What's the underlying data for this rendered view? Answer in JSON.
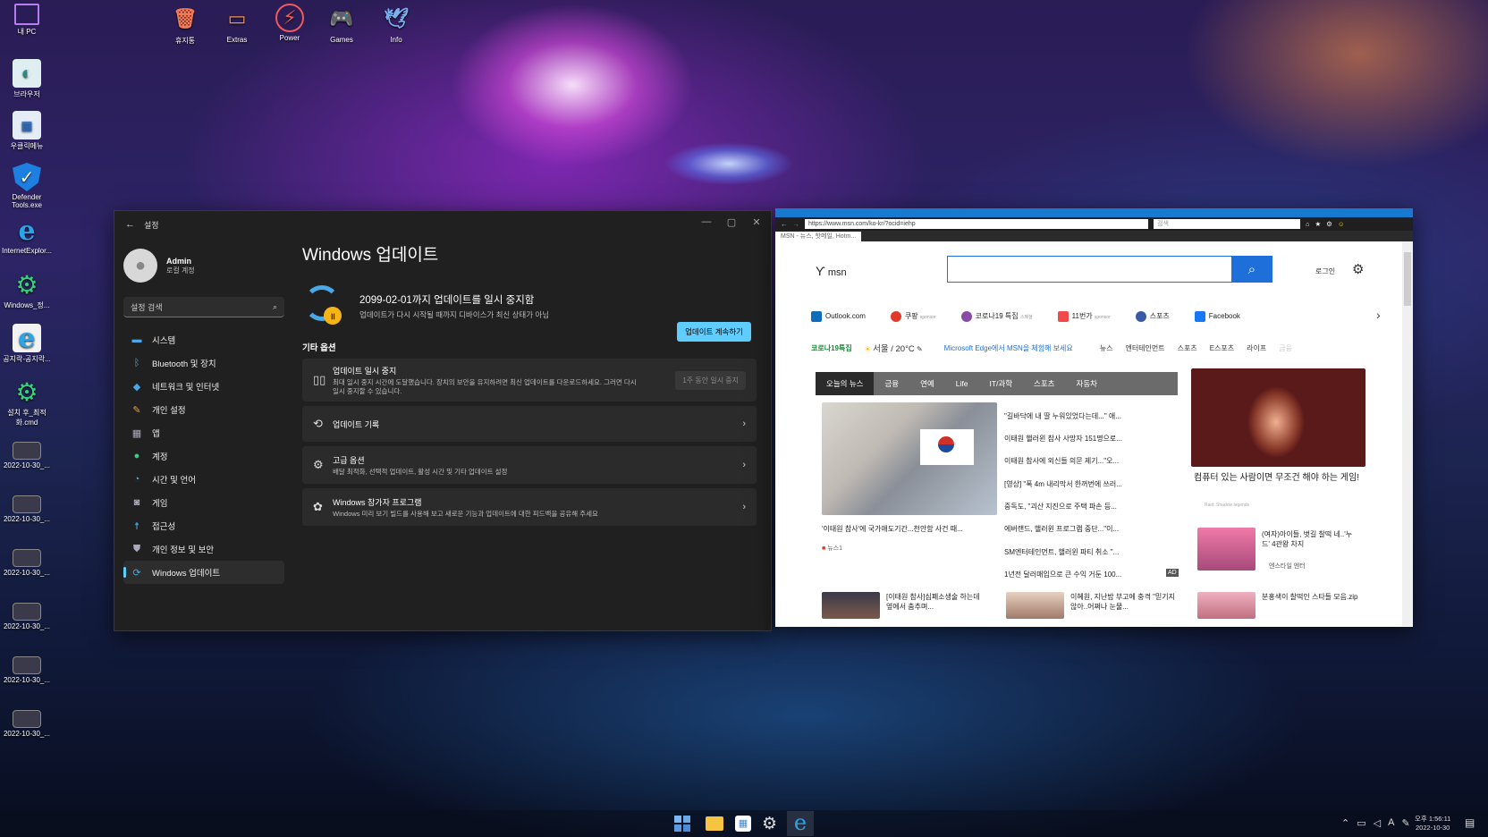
{
  "desktop_icons": [
    "내 PC",
    "브라우저",
    "우클릭메뉴",
    "Defender Tools.exe",
    "InternetExplor...",
    "Windows_정...",
    "공지락-공지락...",
    "설치 후_최적화.cmd",
    "2022-10-30_...",
    "2022-10-30_...",
    "2022-10-30_...",
    "2022-10-30_...",
    "2022-10-30_...",
    "2022-10-30_..."
  ],
  "top_icons": [
    "휴지통",
    "Extras",
    "Power",
    "Games",
    "Info"
  ],
  "settings": {
    "title": "설정",
    "user_name": "Admin",
    "user_type": "로컬 계정",
    "search_placeholder": "설정 검색",
    "nav": [
      "시스템",
      "Bluetooth 및 장치",
      "네트워크 및 인터넷",
      "개인 설정",
      "앱",
      "계정",
      "시간 및 언어",
      "게임",
      "접근성",
      "개인 정보 및 보안",
      "Windows 업데이트"
    ],
    "page_title": "Windows 업데이트",
    "paused_title": "2099-02-01까지 업데이트를 일시 중지함",
    "paused_sub": "업데이트가 다시 시작될 때까지 디바이스가 최신 상태가 아님",
    "resume_button": "업데이트 계속하기",
    "more_options": "기타 옵션",
    "pause_card_title": "업데이트 일시 중지",
    "pause_card_sub": "최대 일시 중지 시간에 도달했습니다. 장치의 보안을 유지하려면 최신 업데이트를 다운로드하세요. 그러면 다시 일시 중지할 수 있습니다.",
    "pause_card_button": "1주 동안 일시 중지",
    "history_title": "업데이트 기록",
    "advanced_title": "고급 옵션",
    "advanced_sub": "배달 최적화, 선택적 업데이트, 활성 시간 및 기타 업데이트 설정",
    "insider_title": "Windows 참가자 프로그램",
    "insider_sub": "Windows 미리 보기 빌드를 사용해 보고 새로운 기능과 업데이트에 대한 피드백을 공유해 주세요"
  },
  "ie": {
    "url": "https://www.msn.com/ko-kr/?ocid=iehp",
    "search_placeholder": "검색",
    "tab_label": "MSN - 뉴스, 핫메일, Hotm...",
    "logo": "msn",
    "login": "로그인",
    "quicklinks": [
      "Outlook.com",
      "쿠팡",
      "코로나19 특집",
      "11번가",
      "스포츠",
      "Facebook"
    ],
    "quicklink_subs": [
      "",
      "sponsor",
      "스페셜",
      "sponsor",
      "",
      ""
    ],
    "covid": "코로나19특집",
    "weather": "서울 / 20°C",
    "edge_promo": "Microsoft Edge에서 MSN을 체험해 보세요",
    "categories": [
      "뉴스",
      "엔터테인먼트",
      "스포츠",
      "E스포츠",
      "라이프",
      "금융"
    ],
    "news_tabs": [
      "오늘의 뉴스",
      "금융",
      "연예",
      "Life",
      "IT/과학",
      "스포츠",
      "자동차"
    ],
    "main_caption": "'이태원 참사'에 국가애도기간...천안함 사건 때...",
    "main_source": "뉴스1",
    "headlines": [
      "\"길바닥에 내 딸 누워있었다는데...\" 애...",
      "이태원 핼러윈 참사 사망자 151명으로...",
      "이태원 참사에 외신들 의문 제기...\"오...",
      "[영상] \"폭 4m 내리막서 한꺼번에 쓰러...",
      "중독도, \"괴산 지진으로 주택 파손 등...",
      "에버랜드, 핼러윈 프로그램 중단...\"이...",
      "SM엔터테인먼트, 핼러윈 파티 취소 \"...",
      "1년전 달러매입으로 큰 수익 거둔 100..."
    ],
    "ad_label": "AD",
    "side_caption": "컴퓨터 있는 사람이면 무조건 해야 하는 게임!",
    "side_sponsor": "Raid: Shadow legends",
    "side2_title": "(여자)아이들, 벗길 찰떡 네..'누드' 4관왕 차지",
    "side2_source": "엔스타일 엔터",
    "bottom": [
      "[이태원 참사]심폐소생술 하는데 옆에서 춤추며...",
      "이혜원, 지난밤 부고에 충격 \"믿기지 않아..어쩌나 눈물...",
      "분홍색이 찰떡인 스타들 모음.zip"
    ]
  },
  "tray": {
    "time": "오후 1:56:11",
    "date": "2022-10-30",
    "ime": "A"
  },
  "colors": {
    "accent": "#60cdff",
    "ie_blue": "#1779cf",
    "msn_blue": "#1e6fd9"
  }
}
